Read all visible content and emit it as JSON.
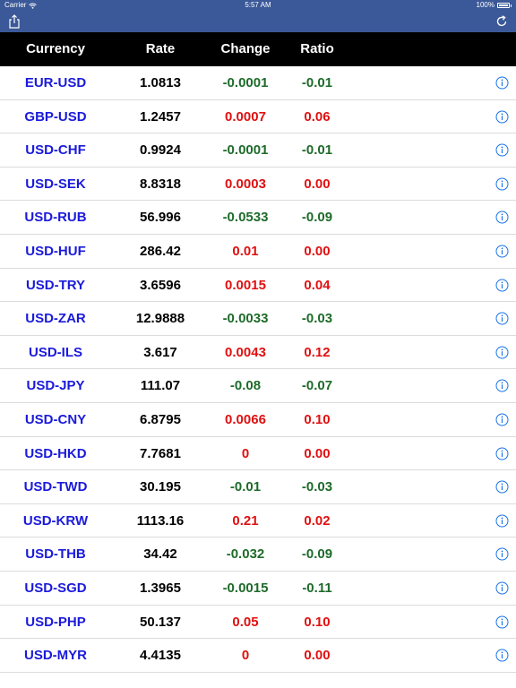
{
  "status_bar": {
    "carrier": "Carrier",
    "time": "5:57 AM",
    "battery": "100%"
  },
  "colors": {
    "nav_background": "#3b5998",
    "header_background": "#000000",
    "currency_text": "#1a1adb",
    "positive": "#e01010",
    "negative": "#1e6b2a",
    "info_icon": "#1a73e8"
  },
  "icons": {
    "share": "share-icon",
    "refresh": "refresh-icon",
    "info": "info-icon",
    "wifi": "wifi-icon",
    "battery": "battery-icon"
  },
  "table": {
    "headers": {
      "currency": "Currency",
      "rate": "Rate",
      "change": "Change",
      "ratio": "Ratio"
    },
    "rows": [
      {
        "pair": "EUR-USD",
        "rate": "1.0813",
        "change": "-0.0001",
        "ratio": "-0.01"
      },
      {
        "pair": "GBP-USD",
        "rate": "1.2457",
        "change": "0.0007",
        "ratio": "0.06"
      },
      {
        "pair": "USD-CHF",
        "rate": "0.9924",
        "change": "-0.0001",
        "ratio": "-0.01"
      },
      {
        "pair": "USD-SEK",
        "rate": "8.8318",
        "change": "0.0003",
        "ratio": "0.00"
      },
      {
        "pair": "USD-RUB",
        "rate": "56.996",
        "change": "-0.0533",
        "ratio": "-0.09"
      },
      {
        "pair": "USD-HUF",
        "rate": "286.42",
        "change": "0.01",
        "ratio": "0.00"
      },
      {
        "pair": "USD-TRY",
        "rate": "3.6596",
        "change": "0.0015",
        "ratio": "0.04"
      },
      {
        "pair": "USD-ZAR",
        "rate": "12.9888",
        "change": "-0.0033",
        "ratio": "-0.03"
      },
      {
        "pair": "USD-ILS",
        "rate": "3.617",
        "change": "0.0043",
        "ratio": "0.12"
      },
      {
        "pair": "USD-JPY",
        "rate": "111.07",
        "change": "-0.08",
        "ratio": "-0.07"
      },
      {
        "pair": "USD-CNY",
        "rate": "6.8795",
        "change": "0.0066",
        "ratio": "0.10"
      },
      {
        "pair": "USD-HKD",
        "rate": "7.7681",
        "change": "0",
        "ratio": "0.00"
      },
      {
        "pair": "USD-TWD",
        "rate": "30.195",
        "change": "-0.01",
        "ratio": "-0.03"
      },
      {
        "pair": "USD-KRW",
        "rate": "1113.16",
        "change": "0.21",
        "ratio": "0.02"
      },
      {
        "pair": "USD-THB",
        "rate": "34.42",
        "change": "-0.032",
        "ratio": "-0.09"
      },
      {
        "pair": "USD-SGD",
        "rate": "1.3965",
        "change": "-0.0015",
        "ratio": "-0.11"
      },
      {
        "pair": "USD-PHP",
        "rate": "50.137",
        "change": "0.05",
        "ratio": "0.10"
      },
      {
        "pair": "USD-MYR",
        "rate": "4.4135",
        "change": "0",
        "ratio": "0.00"
      }
    ]
  }
}
